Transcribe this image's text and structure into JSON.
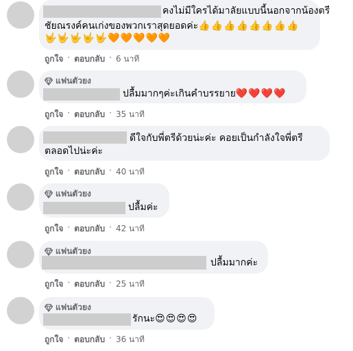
{
  "fan_badge": "แฟนตัวยง",
  "actions": {
    "like": "ถูกใจ",
    "reply": "ตอบกลับ",
    "sep": "·"
  },
  "comments": [
    {
      "text_line1": "คงไม่มีใครได้มาลัยแบบนี้นอกจากน้องตรี",
      "text_line2": "ชัยณรงค์คนเก่งของพวกเราสุดยอดค่ะ",
      "emoji_line2": "👍👍👍👍👍👍👍👍",
      "emoji_line3": "🤟🤟🤟🤟🤟🧡🧡🧡🧡🧡",
      "time": "6 นาที"
    },
    {
      "text": "ปลื้มมากๆค่ะเกินคำบรรยาย",
      "emoji": "❤️❤️❤️❤️",
      "time": "35 นาที"
    },
    {
      "text_line1": "ดีใจกับพี่ตรีด้วยน่ะค่ะ คอยเป็นกำลังใจพี่ตรี",
      "text_line2": "ตลอดไปน่ะค่ะ",
      "time": "40 นาที"
    },
    {
      "text": "ปลื้มค่ะ",
      "time": "42 นาที"
    },
    {
      "text": "ปลื้มมากค่ะ",
      "time": "25 นาที"
    },
    {
      "text": "รักนะ",
      "emoji": "😍😍😍😍",
      "time": "36 นาที"
    }
  ]
}
